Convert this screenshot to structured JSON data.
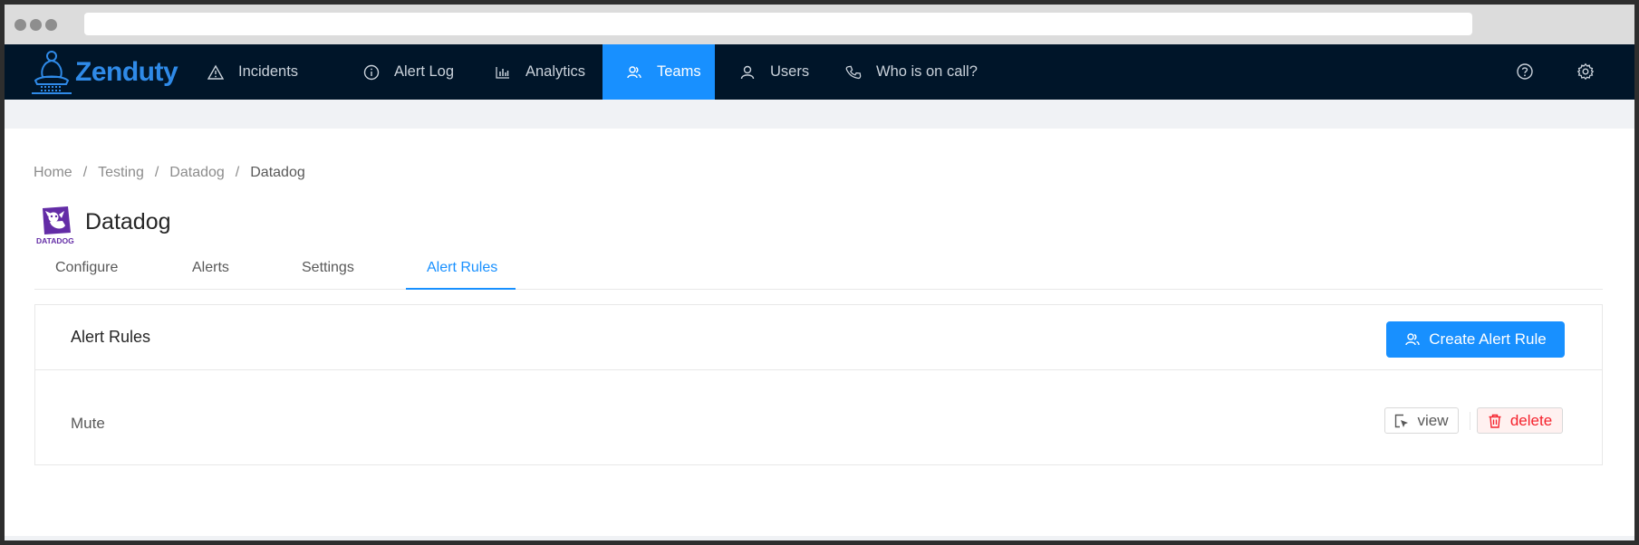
{
  "colors": {
    "nav_bg": "#001529",
    "accent": "#1890ff",
    "brand": "#2f8ae8",
    "danger": "#f5222d",
    "logo_purple": "#632ca6"
  },
  "brand": {
    "name": "Zenduty",
    "logo_icon": "buddha-logo-icon"
  },
  "nav": {
    "items": [
      {
        "label": "Incidents",
        "icon": "warning-triangle-icon"
      },
      {
        "label": "Alert Log",
        "icon": "info-circle-icon"
      },
      {
        "label": "Analytics",
        "icon": "bar-chart-icon"
      },
      {
        "label": "Teams",
        "icon": "team-icon",
        "active": true
      },
      {
        "label": "Users",
        "icon": "user-icon"
      },
      {
        "label": "Who is on call?",
        "icon": "phone-icon"
      }
    ],
    "right_icons": [
      "help-circle-icon",
      "gear-icon"
    ]
  },
  "breadcrumb": [
    "Home",
    "Testing",
    "Datadog",
    "Datadog"
  ],
  "page": {
    "title": "Datadog",
    "logo_text": "DATADOG"
  },
  "tabs": [
    {
      "label": "Configure"
    },
    {
      "label": "Alerts"
    },
    {
      "label": "Settings"
    },
    {
      "label": "Alert Rules",
      "active": true
    }
  ],
  "alert_rules": {
    "title": "Alert Rules",
    "create_button": "Create Alert Rule",
    "rows": [
      {
        "name": "Mute",
        "view_label": "view",
        "delete_label": "delete"
      }
    ]
  }
}
